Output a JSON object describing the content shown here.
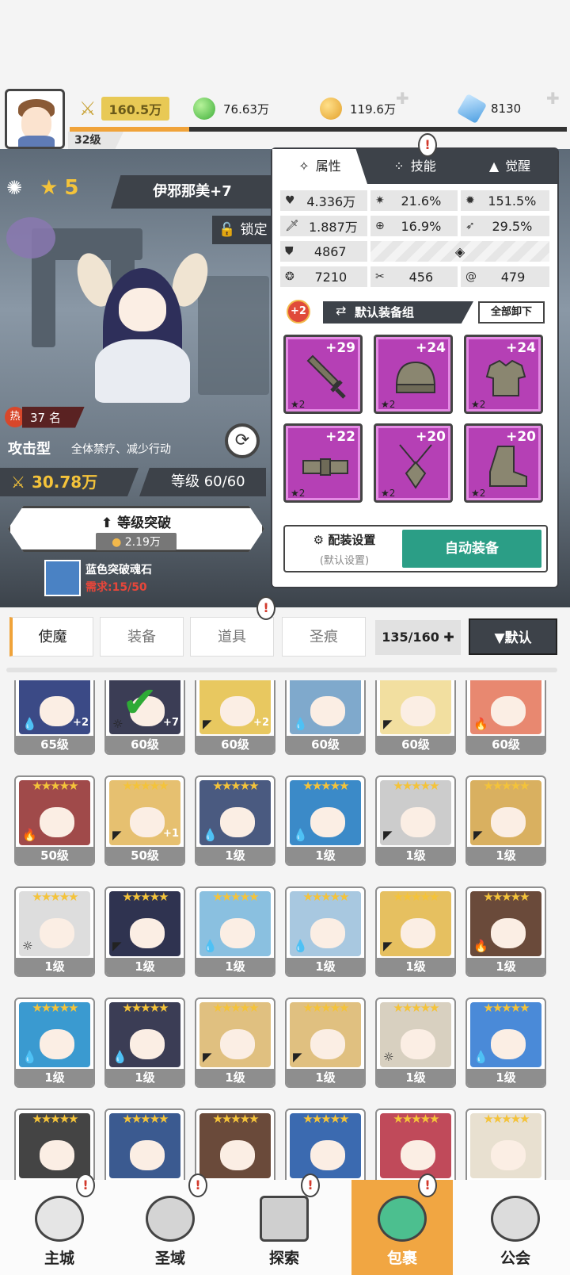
{
  "topbar": {
    "combat_power": "160.5万",
    "green_currency": "76.63万",
    "gold_currency": "119.6万",
    "diamond_currency": "8130",
    "player_level": "32级",
    "exp_progress": 0.24
  },
  "hero": {
    "star_level": "5",
    "name": "伊邪那美+7",
    "lock_label": "锁定",
    "hot_rank": "37 名",
    "hot_icon": "热",
    "type": "攻击型",
    "skill_desc": "全体禁疗、减少行动",
    "power": "30.78万",
    "level": "等级 60/60",
    "breakthrough_label": "等级突破",
    "breakthrough_cost": "2.19万",
    "stone_name": "蓝色突破魂石",
    "stone_requirement": "需求:15/50"
  },
  "panel": {
    "tabs": [
      {
        "label": "属性",
        "icon": "attributes-icon"
      },
      {
        "label": "技能",
        "icon": "skill-icon"
      },
      {
        "label": "觉醒",
        "icon": "awaken-icon"
      }
    ],
    "stats": {
      "hp": "4.336万",
      "crit_rate": "21.6%",
      "crit_damage": "151.5%",
      "attack": "1.887万",
      "accuracy": "16.9%",
      "speed_pct": "29.5%",
      "defense": "4867",
      "power_stat": "7210",
      "stat_a": "456",
      "stat_b": "479"
    },
    "set_bonus": "+2",
    "equip_set_label": "默认装备组",
    "unequip_all_label": "全部卸下",
    "equipment": [
      {
        "slot": "sword",
        "level": "+29",
        "stars": "★2"
      },
      {
        "slot": "helmet",
        "level": "+24",
        "stars": "★2"
      },
      {
        "slot": "armor",
        "level": "+24",
        "stars": "★2"
      },
      {
        "slot": "belt",
        "level": "+22",
        "stars": "★2"
      },
      {
        "slot": "necklace",
        "level": "+20",
        "stars": "★2"
      },
      {
        "slot": "boots",
        "level": "+20",
        "stars": "★2"
      }
    ],
    "config_label": "配装设置",
    "config_sub": "(默认设置)",
    "auto_equip_label": "自动装备"
  },
  "inventory": {
    "tabs": [
      "使魔",
      "装备",
      "道具",
      "圣痕"
    ],
    "count": "135/160",
    "sort_label": "▼默认"
  },
  "heroes": [
    {
      "level": "65级",
      "bonus": "+2",
      "color": "#3b4a86",
      "element": "💧"
    },
    {
      "level": "60级",
      "bonus": "+7",
      "color": "#3b3d55",
      "element": "☼",
      "selected": true
    },
    {
      "level": "60级",
      "bonus": "+2",
      "color": "#e8c860",
      "element": "◤"
    },
    {
      "level": "60级",
      "bonus": "",
      "color": "#7fa9cc",
      "element": "💧"
    },
    {
      "level": "60级",
      "bonus": "",
      "color": "#f2dfa0",
      "element": "◤"
    },
    {
      "level": "60级",
      "bonus": "",
      "color": "#e88870",
      "element": "🔥"
    },
    {
      "level": "50级",
      "bonus": "",
      "color": "#a04a4a",
      "element": "🔥"
    },
    {
      "level": "50级",
      "bonus": "+1",
      "color": "#e6c070",
      "element": "◤"
    },
    {
      "level": "1级",
      "bonus": "",
      "color": "#4a5a80",
      "element": "💧"
    },
    {
      "level": "1级",
      "bonus": "",
      "color": "#3b8ac8",
      "element": "💧"
    },
    {
      "level": "1级",
      "bonus": "",
      "color": "#cccccc",
      "element": "◤"
    },
    {
      "level": "1级",
      "bonus": "",
      "color": "#d9b060",
      "element": "◤"
    },
    {
      "level": "1级",
      "bonus": "",
      "color": "#dddddd",
      "element": "☼"
    },
    {
      "level": "1级",
      "bonus": "",
      "color": "#2f3350",
      "element": "◤"
    },
    {
      "level": "1级",
      "bonus": "",
      "color": "#8ac0e0",
      "element": "💧"
    },
    {
      "level": "1级",
      "bonus": "",
      "color": "#a8c8e0",
      "element": "💧"
    },
    {
      "level": "1级",
      "bonus": "",
      "color": "#e6c060",
      "element": "◤"
    },
    {
      "level": "1级",
      "bonus": "",
      "color": "#6a4a3a",
      "element": "🔥"
    },
    {
      "level": "1级",
      "bonus": "",
      "color": "#3a9ad0",
      "element": "💧"
    },
    {
      "level": "1级",
      "bonus": "",
      "color": "#3b3d55",
      "element": "💧"
    },
    {
      "level": "1级",
      "bonus": "",
      "color": "#e0c080",
      "element": "◤"
    },
    {
      "level": "1级",
      "bonus": "",
      "color": "#e0c080",
      "element": "◤"
    },
    {
      "level": "1级",
      "bonus": "",
      "color": "#d8d0c0",
      "element": "☼"
    },
    {
      "level": "1级",
      "bonus": "",
      "color": "#4a8ad8",
      "element": "💧"
    },
    {
      "level": "",
      "bonus": "",
      "color": "#444444",
      "element": ""
    },
    {
      "level": "",
      "bonus": "",
      "color": "#3b5a90",
      "element": ""
    },
    {
      "level": "",
      "bonus": "",
      "color": "#6a4a3a",
      "element": ""
    },
    {
      "level": "",
      "bonus": "",
      "color": "#3b6ab0",
      "element": ""
    },
    {
      "level": "",
      "bonus": "",
      "color": "#c04a5a",
      "element": ""
    },
    {
      "level": "",
      "bonus": "",
      "color": "#e8e0d0",
      "element": ""
    }
  ],
  "nav": [
    {
      "label": "主城",
      "icon": "castle-icon"
    },
    {
      "label": "圣域",
      "icon": "sanctuary-icon"
    },
    {
      "label": "探索",
      "icon": "explore-icon"
    },
    {
      "label": "包裹",
      "icon": "bag-icon",
      "active": true
    },
    {
      "label": "公会",
      "icon": "guild-icon"
    }
  ],
  "alert_mark": "!"
}
